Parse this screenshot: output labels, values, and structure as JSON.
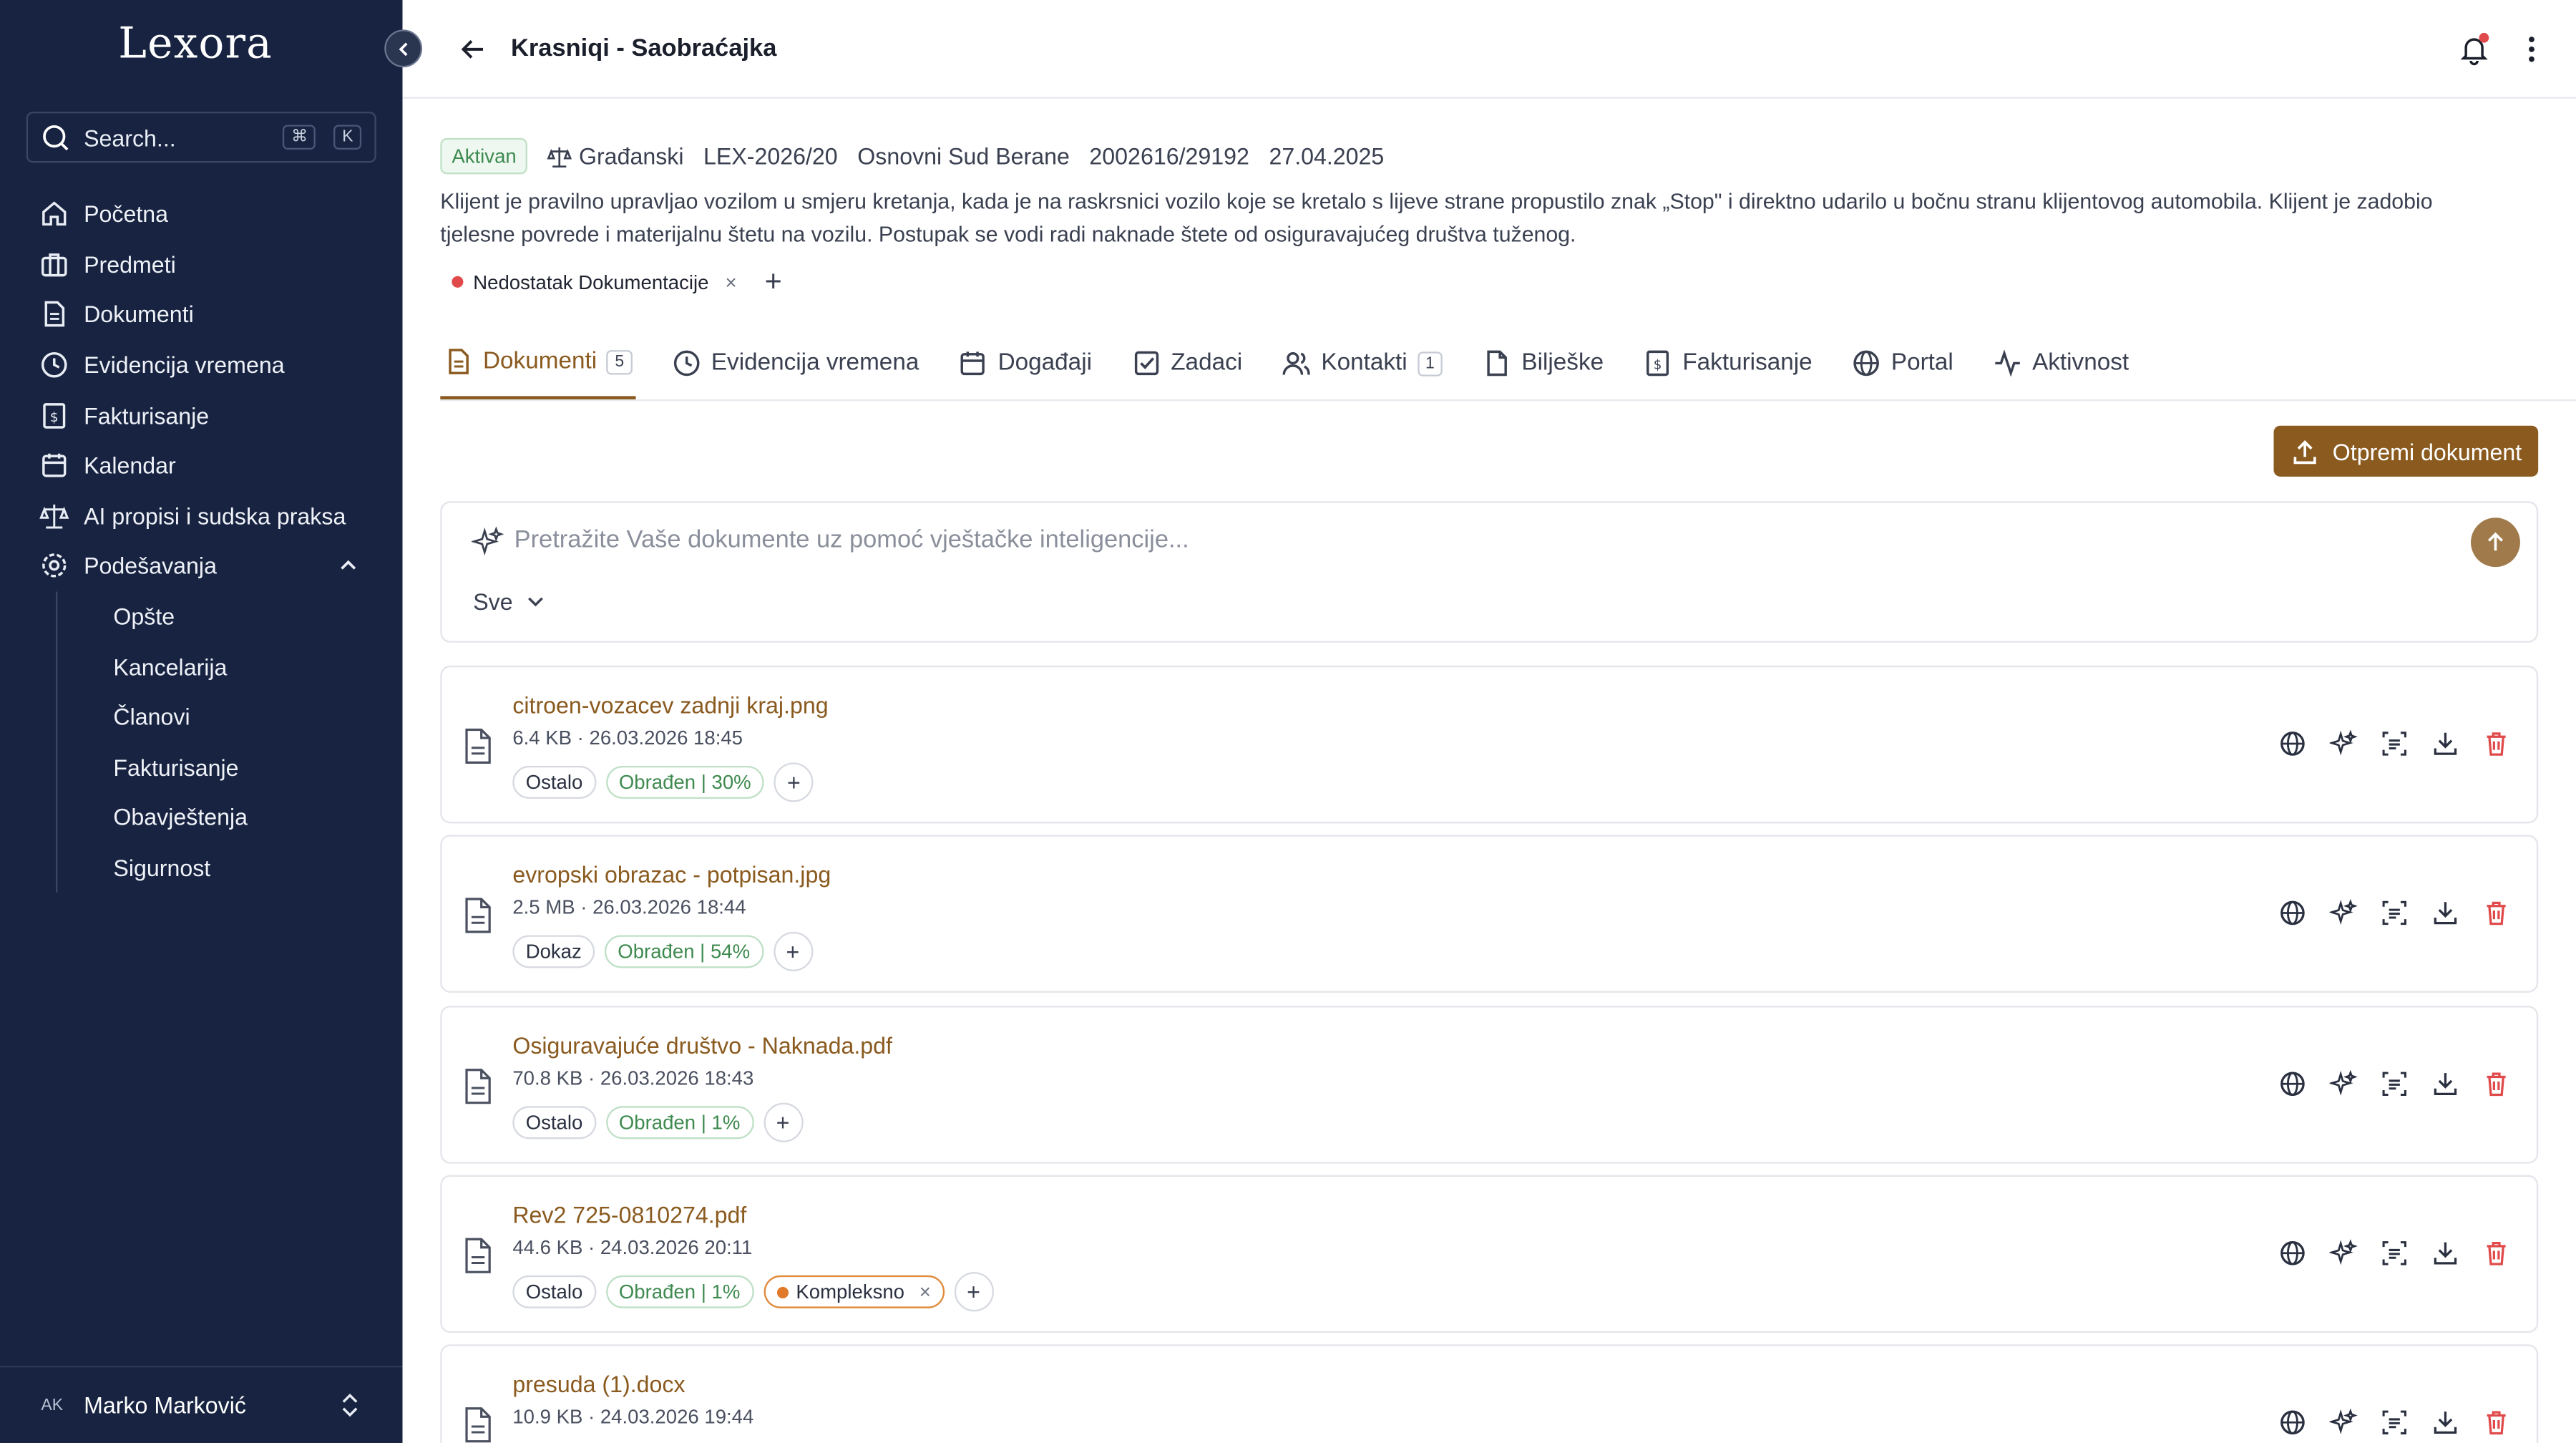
{
  "app": {
    "logo": "Lexora"
  },
  "sidebar": {
    "search_label": "Search...",
    "shortcut_cmd": "⌘",
    "shortcut_key": "K",
    "items": [
      {
        "label": "Početna",
        "icon": "home-icon"
      },
      {
        "label": "Predmeti",
        "icon": "briefcase-icon"
      },
      {
        "label": "Dokumenti",
        "icon": "document-icon"
      },
      {
        "label": "Evidencija vremena",
        "icon": "clock-icon"
      },
      {
        "label": "Fakturisanje",
        "icon": "invoice-icon"
      },
      {
        "label": "Kalendar",
        "icon": "calendar-icon"
      },
      {
        "label": "AI propisi i sudska praksa",
        "icon": "scale-icon"
      },
      {
        "label": "Podešavanja",
        "icon": "gear-icon"
      }
    ],
    "settings_sub": [
      "Opšte",
      "Kancelarija",
      "Članovi",
      "Fakturisanje",
      "Obavještenja",
      "Sigurnost"
    ],
    "user": {
      "initials": "AK",
      "name": "Marko Marković"
    }
  },
  "header": {
    "title": "Krasniqi - Saobraćajka"
  },
  "case": {
    "status": "Aktivan",
    "type": "Građanski",
    "number": "LEX-2026/20",
    "court": "Osnovni Sud Berane",
    "court_number": "2002616/29192",
    "date": "27.04.2025",
    "description": "Klijent je pravilno upravljao vozilom u smjeru kretanja, kada je na raskrsnici vozilo koje se kretalo s lijeve strane propustilo znak „Stop\" i direktno udarilo u bočnu stranu klijentovog automobila. Klijent je zadobio tjelesne povrede i materijalnu štetu na vozilu. Postupak se vodi radi naknade štete od osiguravajućeg društva tuženog.",
    "tag": "Nedostatak Dokumentacije",
    "tag_remove": "×",
    "add": "+"
  },
  "tabs": [
    {
      "label": "Dokumenti",
      "count": "5"
    },
    {
      "label": "Evidencija vremena"
    },
    {
      "label": "Događaji"
    },
    {
      "label": "Zadaci"
    },
    {
      "label": "Kontakti",
      "count": "1"
    },
    {
      "label": "Bilješke"
    },
    {
      "label": "Fakturisanje"
    },
    {
      "label": "Portal"
    },
    {
      "label": "Aktivnost"
    }
  ],
  "upload_label": "Otpremi dokument",
  "ai_search": {
    "placeholder": "Pretražite Vaše dokumente uz pomoć vještačke inteligencije...",
    "filter": "Sve"
  },
  "documents": [
    {
      "name": "citroen-vozacev zadnji kraj.png",
      "info": "6.4 KB · 26.03.2026 18:45",
      "category": "Ostalo",
      "status": "Obrađen | 30%"
    },
    {
      "name": "evropski obrazac - potpisan.jpg",
      "info": "2.5 MB · 26.03.2026 18:44",
      "category": "Dokaz",
      "status": "Obrađen | 54%"
    },
    {
      "name": "Osiguravajuće društvo - Naknada.pdf",
      "info": "70.8 KB · 26.03.2026 18:43",
      "category": "Ostalo",
      "status": "Obrađen | 1%"
    },
    {
      "name": "Rev2 725-0810274.pdf",
      "info": "44.6 KB · 24.03.2026 20:11",
      "category": "Ostalo",
      "status": "Obrađen | 1%",
      "extra_tag": "Kompleksno",
      "extra_remove": "×"
    },
    {
      "name": "presuda (1).docx",
      "info": "10.9 KB · 24.03.2026 19:44",
      "category": "",
      "status": ""
    }
  ],
  "colors": {
    "sidebar": "#172340",
    "accent": "#8a5a1f",
    "success": "#3e8a4f",
    "danger": "#e04a4a"
  }
}
